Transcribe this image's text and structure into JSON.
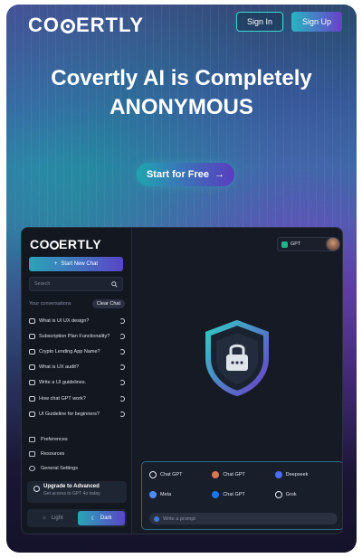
{
  "nav": {
    "brand": "COVERTLY",
    "sign_in": "Sign In",
    "sign_up": "Sign Up"
  },
  "hero": {
    "title_line1": "Covertly AI is Completely",
    "title_line2": "ANONYMOUS",
    "cta": "Start for Free",
    "cta_arrow": "→"
  },
  "app": {
    "brand": "COVERTLY",
    "new_chat": "Start New Chat",
    "search_placeholder": "Search",
    "conversations_label": "Your conversations",
    "clear_chat": "Clear Chat",
    "conversations": [
      "What is UI UX design?",
      "Subscription Plan Functionality?",
      "Crypto Lending App Name?",
      "What is UX audit?",
      "Write a UI guidelines.",
      "How chat GPT work?",
      "UI Guideline for beginners?"
    ],
    "menu": [
      "Preferences",
      "Resources",
      "General Settings"
    ],
    "upgrade": {
      "title": "Upgrade to Advanced",
      "subtitle": "Get access to GPT 4o today"
    },
    "theme": {
      "light": "Light",
      "dark": "Dark",
      "active": "Dark"
    },
    "model_selector": "GPT",
    "models": [
      {
        "name": "Chat GPT",
        "icon": "openai-icon",
        "color": "#e9ecf2"
      },
      {
        "name": "Chat GPT",
        "icon": "claude-icon",
        "color": "#d9774f"
      },
      {
        "name": "Deepseek",
        "icon": "deepseek-icon",
        "color": "#4d6bfe"
      },
      {
        "name": "Meta",
        "icon": "gemini-icon",
        "color": "#4a8df6"
      },
      {
        "name": "Chat GPT",
        "icon": "meta-icon",
        "color": "#1877f2"
      },
      {
        "name": "Grok",
        "icon": "grok-icon",
        "color": "#e9ecf2"
      }
    ],
    "prompt_placeholder": "Write a prompt"
  },
  "colors": {
    "accent_teal": "#27b6c1",
    "accent_purple": "#6a3fc8",
    "app_bg": "#151a24"
  }
}
